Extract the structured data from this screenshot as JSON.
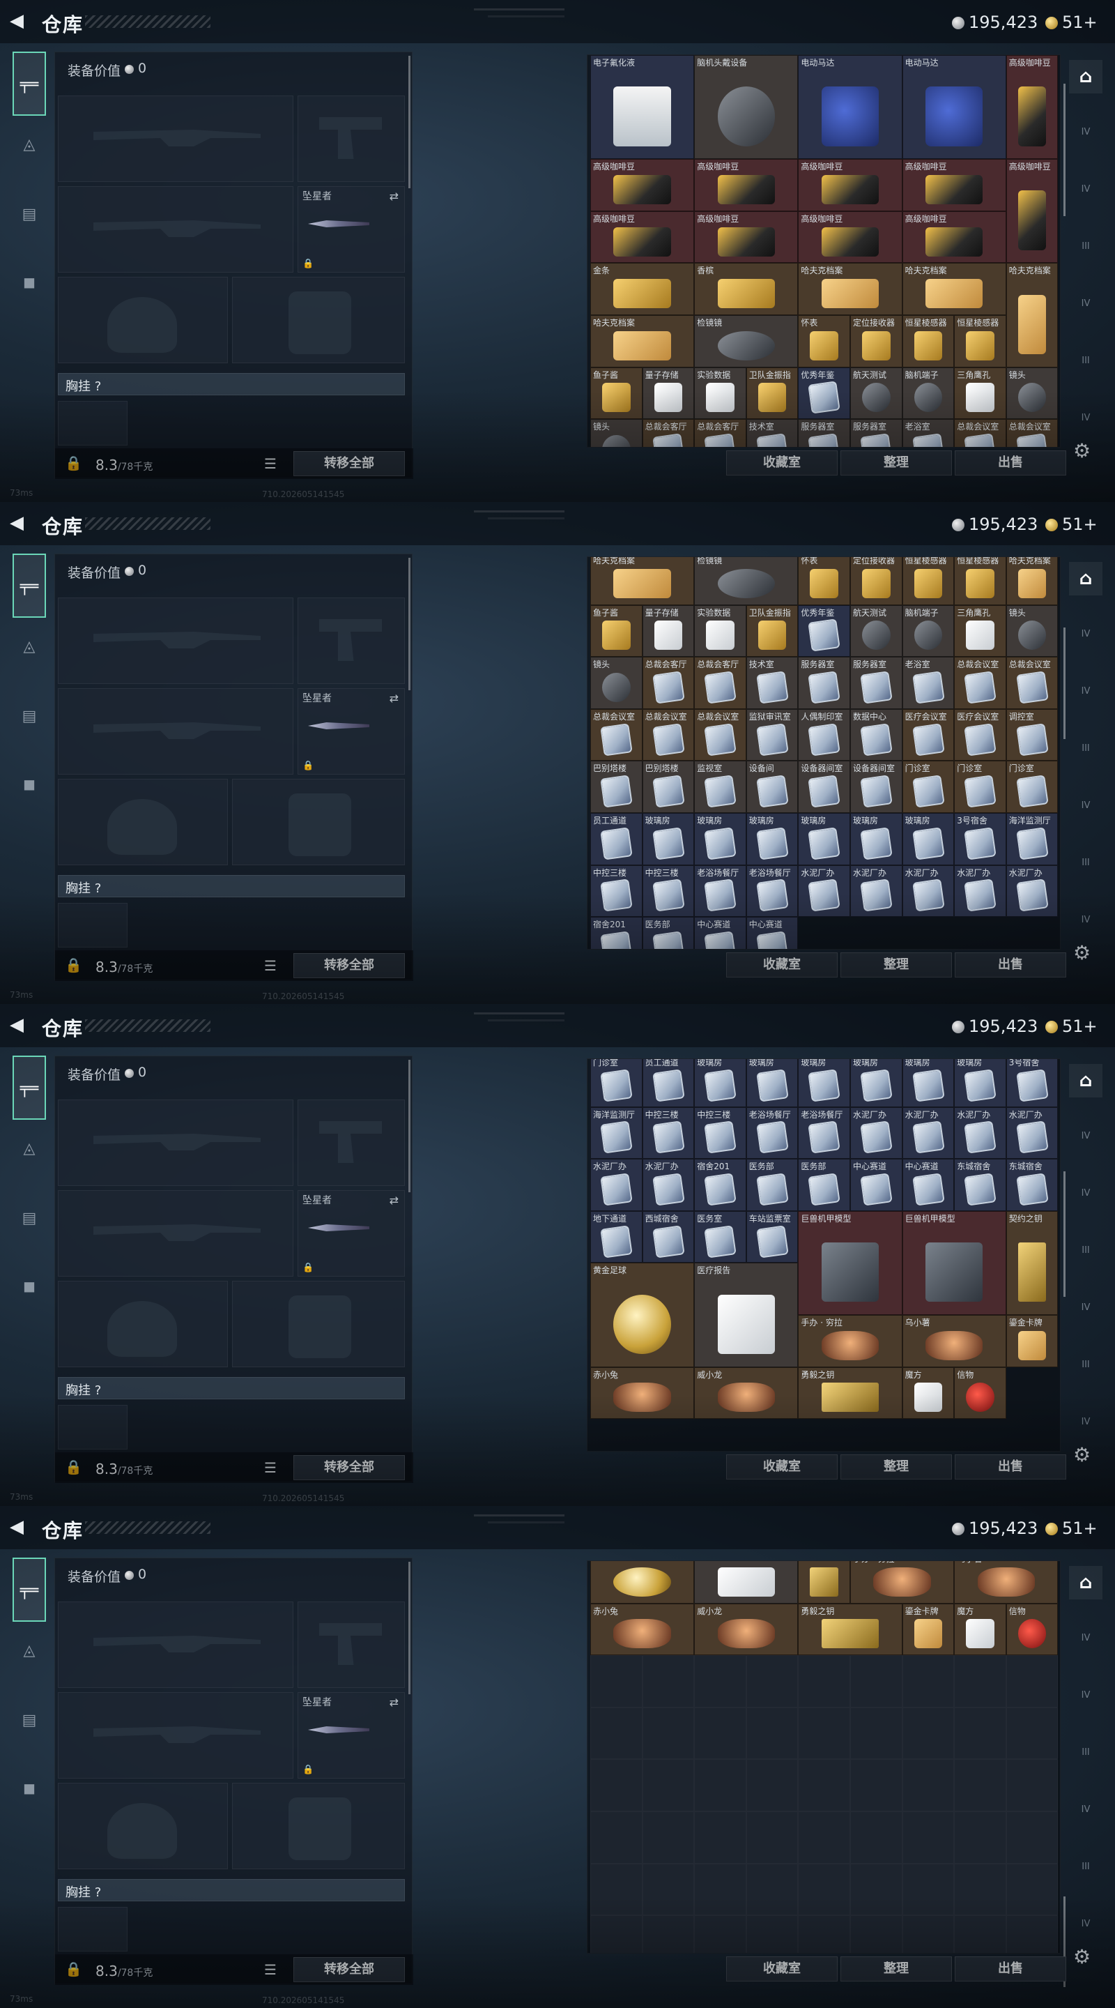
{
  "header": {
    "title": "仓库",
    "back": "◀",
    "silver": "195,423",
    "gold": "51+"
  },
  "loadout": {
    "value_label": "装备价值",
    "value": "0",
    "melee_label": "坠星者",
    "chest_label": "胸挂 ?",
    "weight": "8.3",
    "weight_unit": "/78千克",
    "transfer_label": "转移全部"
  },
  "actions": {
    "collection": "收藏室",
    "sort": "整理",
    "sell": "出售"
  },
  "footer": {
    "ping": "73ms",
    "build": "710.202605141545"
  },
  "left_nav": [
    "pistol-icon",
    "helmet-icon",
    "backpack-icon",
    "briefcase-icon"
  ],
  "right_nav": [
    "IV",
    "IV",
    "III",
    "IV",
    "III",
    "IV"
  ],
  "inventory": {
    "p1": [
      {
        "n": "电子氟化液",
        "c": "b",
        "i": "jug",
        "w": 2,
        "h": 2
      },
      {
        "n": "脑机头戴设备",
        "c": "g",
        "i": "dark",
        "w": 2,
        "h": 2
      },
      {
        "n": "电动马达",
        "c": "b",
        "i": "blue",
        "w": 2,
        "h": 2
      },
      {
        "n": "电动马达",
        "c": "b",
        "i": "blue",
        "w": 2,
        "h": 2
      },
      {
        "n": "高级咖啡豆",
        "c": "r",
        "i": "coffee",
        "w": 1,
        "h": 2
      },
      {
        "n": "高级咖啡豆",
        "c": "r",
        "i": "coffee",
        "w": 2,
        "h": 1
      },
      {
        "n": "高级咖啡豆",
        "c": "r",
        "i": "coffee",
        "w": 2,
        "h": 1
      },
      {
        "n": "高级咖啡豆",
        "c": "r",
        "i": "coffee",
        "w": 2,
        "h": 1
      },
      {
        "n": "高级咖啡豆",
        "c": "r",
        "i": "coffee",
        "w": 2,
        "h": 1
      },
      {
        "n": "高级咖啡豆",
        "c": "r",
        "i": "coffee",
        "w": 1,
        "h": 2
      },
      {
        "n": "高级咖啡豆",
        "c": "r",
        "i": "coffee",
        "w": 2,
        "h": 1
      },
      {
        "n": "高级咖啡豆",
        "c": "r",
        "i": "coffee",
        "w": 2,
        "h": 1
      },
      {
        "n": "高级咖啡豆",
        "c": "r",
        "i": "coffee",
        "w": 2,
        "h": 1
      },
      {
        "n": "高级咖啡豆",
        "c": "r",
        "i": "coffee",
        "w": 2,
        "h": 1
      },
      {
        "n": "金条",
        "c": "y",
        "i": "gold",
        "w": 2,
        "h": 1
      },
      {
        "n": "香槟",
        "c": "y",
        "i": "gold",
        "w": 2,
        "h": 1
      },
      {
        "n": "哈夫克档案",
        "c": "y",
        "i": "file",
        "w": 2,
        "h": 1
      },
      {
        "n": "哈夫克档案",
        "c": "y",
        "i": "file",
        "w": 2,
        "h": 1
      },
      {
        "n": "哈夫克档案",
        "c": "y",
        "i": "file",
        "w": 1,
        "h": 2
      },
      {
        "n": "哈夫克档案",
        "c": "y",
        "i": "file",
        "w": 2,
        "h": 1
      },
      {
        "n": "检镜镜",
        "c": "g",
        "i": "dark",
        "w": 2,
        "h": 1
      },
      {
        "n": "怀表",
        "c": "y",
        "i": "gold",
        "w": 1,
        "h": 1
      },
      {
        "n": "定位接收器",
        "c": "y",
        "i": "gold",
        "w": 1,
        "h": 1
      },
      {
        "n": "恒星棱感器",
        "c": "y",
        "i": "gold",
        "w": 1,
        "h": 1
      },
      {
        "n": "恒星棱感器",
        "c": "y",
        "i": "gold",
        "w": 1,
        "h": 1
      },
      {
        "n": "鱼子酱",
        "c": "y",
        "i": "gold",
        "w": 1,
        "h": 1
      },
      {
        "n": "量子存储",
        "c": "g",
        "i": "white",
        "w": 1,
        "h": 1
      },
      {
        "n": "实验数据",
        "c": "g",
        "i": "white",
        "w": 1,
        "h": 1
      },
      {
        "n": "卫队金振指",
        "c": "y",
        "i": "gold",
        "w": 1,
        "h": 1
      },
      {
        "n": "优秀年鉴",
        "c": "b",
        "i": "card",
        "w": 1,
        "h": 1
      },
      {
        "n": "航天测试",
        "c": "g",
        "i": "dark",
        "w": 1,
        "h": 1
      },
      {
        "n": "脑机端子",
        "c": "g",
        "i": "dark",
        "w": 1,
        "h": 1
      },
      {
        "n": "三角鹰孔",
        "c": "y",
        "i": "white",
        "w": 1,
        "h": 1
      },
      {
        "n": "镜头",
        "c": "g",
        "i": "dark",
        "w": 1,
        "h": 1
      },
      {
        "n": "镜头",
        "c": "g",
        "i": "dark",
        "w": 1,
        "h": 1
      },
      {
        "n": "总裁会客厅",
        "c": "y",
        "i": "card",
        "w": 1,
        "h": 1
      },
      {
        "n": "总裁会客厅",
        "c": "y",
        "i": "card",
        "w": 1,
        "h": 1
      },
      {
        "n": "技术室",
        "c": "g",
        "i": "card",
        "w": 1,
        "h": 1
      },
      {
        "n": "服务器室",
        "c": "g",
        "i": "card",
        "w": 1,
        "h": 1
      },
      {
        "n": "服务器室",
        "c": "g",
        "i": "card",
        "w": 1,
        "h": 1
      },
      {
        "n": "老浴室",
        "c": "g",
        "i": "card",
        "w": 1,
        "h": 1
      },
      {
        "n": "总裁会议室",
        "c": "y",
        "i": "card",
        "w": 1,
        "h": 1
      },
      {
        "n": "总裁会议室",
        "c": "y",
        "i": "card",
        "w": 1,
        "h": 1
      }
    ],
    "p2": [
      {
        "n": "哈夫克档案",
        "c": "y",
        "i": "file",
        "w": 2,
        "h": 1
      },
      {
        "n": "检镜镜",
        "c": "g",
        "i": "dark",
        "w": 2,
        "h": 1
      },
      {
        "n": "怀表",
        "c": "y",
        "i": "gold",
        "w": 1,
        "h": 1
      },
      {
        "n": "定位接收器",
        "c": "y",
        "i": "gold",
        "w": 1,
        "h": 1
      },
      {
        "n": "恒星棱感器",
        "c": "y",
        "i": "gold",
        "w": 1,
        "h": 1
      },
      {
        "n": "恒星棱感器",
        "c": "y",
        "i": "gold",
        "w": 1,
        "h": 1
      },
      {
        "n": "哈夫克档案",
        "c": "y",
        "i": "file",
        "w": 1,
        "h": 1
      },
      {
        "n": "鱼子酱",
        "c": "y",
        "i": "gold",
        "w": 1,
        "h": 1
      },
      {
        "n": "量子存储",
        "c": "g",
        "i": "white",
        "w": 1,
        "h": 1
      },
      {
        "n": "实验数据",
        "c": "g",
        "i": "white",
        "w": 1,
        "h": 1
      },
      {
        "n": "卫队金振指",
        "c": "y",
        "i": "gold",
        "w": 1,
        "h": 1
      },
      {
        "n": "优秀年鉴",
        "c": "b",
        "i": "card",
        "w": 1,
        "h": 1
      },
      {
        "n": "航天测试",
        "c": "g",
        "i": "dark",
        "w": 1,
        "h": 1
      },
      {
        "n": "脑机端子",
        "c": "g",
        "i": "dark",
        "w": 1,
        "h": 1
      },
      {
        "n": "三角鹰孔",
        "c": "y",
        "i": "white",
        "w": 1,
        "h": 1
      },
      {
        "n": "镜头",
        "c": "g",
        "i": "dark",
        "w": 1,
        "h": 1
      },
      {
        "n": "镜头",
        "c": "g",
        "i": "dark",
        "w": 1,
        "h": 1
      },
      {
        "n": "总裁会客厅",
        "c": "y",
        "i": "card",
        "w": 1,
        "h": 1
      },
      {
        "n": "总裁会客厅",
        "c": "y",
        "i": "card",
        "w": 1,
        "h": 1
      },
      {
        "n": "技术室",
        "c": "g",
        "i": "card",
        "w": 1,
        "h": 1
      },
      {
        "n": "服务器室",
        "c": "g",
        "i": "card",
        "w": 1,
        "h": 1
      },
      {
        "n": "服务器室",
        "c": "g",
        "i": "card",
        "w": 1,
        "h": 1
      },
      {
        "n": "老浴室",
        "c": "g",
        "i": "card",
        "w": 1,
        "h": 1
      },
      {
        "n": "总裁会议室",
        "c": "y",
        "i": "card",
        "w": 1,
        "h": 1
      },
      {
        "n": "总裁会议室",
        "c": "y",
        "i": "card",
        "w": 1,
        "h": 1
      },
      {
        "n": "总裁会议室",
        "c": "y",
        "i": "card",
        "w": 1,
        "h": 1
      },
      {
        "n": "总裁会议室",
        "c": "y",
        "i": "card",
        "w": 1,
        "h": 1
      },
      {
        "n": "总裁会议室",
        "c": "y",
        "i": "card",
        "w": 1,
        "h": 1
      },
      {
        "n": "监狱审讯室",
        "c": "g",
        "i": "card",
        "w": 1,
        "h": 1
      },
      {
        "n": "人偶制印室",
        "c": "g",
        "i": "card",
        "w": 1,
        "h": 1
      },
      {
        "n": "数据中心",
        "c": "g",
        "i": "card",
        "w": 1,
        "h": 1
      },
      {
        "n": "医疗会议室",
        "c": "y",
        "i": "card",
        "w": 1,
        "h": 1
      },
      {
        "n": "医疗会议室",
        "c": "y",
        "i": "card",
        "w": 1,
        "h": 1
      },
      {
        "n": "调控室",
        "c": "y",
        "i": "card",
        "w": 1,
        "h": 1
      },
      {
        "n": "巴别塔楼",
        "c": "g",
        "i": "card",
        "w": 1,
        "h": 1
      },
      {
        "n": "巴别塔楼",
        "c": "g",
        "i": "card",
        "w": 1,
        "h": 1
      },
      {
        "n": "监视室",
        "c": "g",
        "i": "card",
        "w": 1,
        "h": 1
      },
      {
        "n": "设备间",
        "c": "g",
        "i": "card",
        "w": 1,
        "h": 1
      },
      {
        "n": "设备器间室",
        "c": "g",
        "i": "card",
        "w": 1,
        "h": 1
      },
      {
        "n": "设备器间室",
        "c": "g",
        "i": "card",
        "w": 1,
        "h": 1
      },
      {
        "n": "门诊室",
        "c": "y",
        "i": "card",
        "w": 1,
        "h": 1
      },
      {
        "n": "门诊室",
        "c": "y",
        "i": "card",
        "w": 1,
        "h": 1
      },
      {
        "n": "门诊室",
        "c": "y",
        "i": "card",
        "w": 1,
        "h": 1
      },
      {
        "n": "员工通道",
        "c": "b",
        "i": "card",
        "w": 1,
        "h": 1
      },
      {
        "n": "玻璃房",
        "c": "b",
        "i": "card",
        "w": 1,
        "h": 1
      },
      {
        "n": "玻璃房",
        "c": "b",
        "i": "card",
        "w": 1,
        "h": 1
      },
      {
        "n": "玻璃房",
        "c": "b",
        "i": "card",
        "w": 1,
        "h": 1
      },
      {
        "n": "玻璃房",
        "c": "b",
        "i": "card",
        "w": 1,
        "h": 1
      },
      {
        "n": "玻璃房",
        "c": "b",
        "i": "card",
        "w": 1,
        "h": 1
      },
      {
        "n": "玻璃房",
        "c": "b",
        "i": "card",
        "w": 1,
        "h": 1
      },
      {
        "n": "3号宿舍",
        "c": "b",
        "i": "card",
        "w": 1,
        "h": 1
      },
      {
        "n": "海洋监测厅",
        "c": "b",
        "i": "card",
        "w": 1,
        "h": 1
      },
      {
        "n": "中控三楼",
        "c": "b",
        "i": "card",
        "w": 1,
        "h": 1
      },
      {
        "n": "中控三楼",
        "c": "b",
        "i": "card",
        "w": 1,
        "h": 1
      },
      {
        "n": "老浴场餐厅",
        "c": "b",
        "i": "card",
        "w": 1,
        "h": 1
      },
      {
        "n": "老浴场餐厅",
        "c": "b",
        "i": "card",
        "w": 1,
        "h": 1
      },
      {
        "n": "水泥厂办",
        "c": "b",
        "i": "card",
        "w": 1,
        "h": 1
      },
      {
        "n": "水泥厂办",
        "c": "b",
        "i": "card",
        "w": 1,
        "h": 1
      },
      {
        "n": "水泥厂办",
        "c": "b",
        "i": "card",
        "w": 1,
        "h": 1
      },
      {
        "n": "水泥厂办",
        "c": "b",
        "i": "card",
        "w": 1,
        "h": 1
      },
      {
        "n": "水泥厂办",
        "c": "b",
        "i": "card",
        "w": 1,
        "h": 1
      },
      {
        "n": "宿舍201",
        "c": "b",
        "i": "card",
        "w": 1,
        "h": 1
      },
      {
        "n": "医务部",
        "c": "b",
        "i": "card",
        "w": 1,
        "h": 1
      },
      {
        "n": "中心赛道",
        "c": "b",
        "i": "card",
        "w": 1,
        "h": 1
      },
      {
        "n": "中心赛道",
        "c": "b",
        "i": "card",
        "w": 1,
        "h": 1
      }
    ],
    "p3": [
      {
        "n": "门诊室",
        "c": "b",
        "i": "card",
        "w": 1,
        "h": 1
      },
      {
        "n": "员工通道",
        "c": "b",
        "i": "card",
        "w": 1,
        "h": 1
      },
      {
        "n": "玻璃房",
        "c": "b",
        "i": "card",
        "w": 1,
        "h": 1
      },
      {
        "n": "玻璃房",
        "c": "b",
        "i": "card",
        "w": 1,
        "h": 1
      },
      {
        "n": "玻璃房",
        "c": "b",
        "i": "card",
        "w": 1,
        "h": 1
      },
      {
        "n": "玻璃房",
        "c": "b",
        "i": "card",
        "w": 1,
        "h": 1
      },
      {
        "n": "玻璃房",
        "c": "b",
        "i": "card",
        "w": 1,
        "h": 1
      },
      {
        "n": "玻璃房",
        "c": "b",
        "i": "card",
        "w": 1,
        "h": 1
      },
      {
        "n": "3号宿舍",
        "c": "b",
        "i": "card",
        "w": 1,
        "h": 1
      },
      {
        "n": "海洋监测厅",
        "c": "b",
        "i": "card",
        "w": 1,
        "h": 1
      },
      {
        "n": "中控三楼",
        "c": "b",
        "i": "card",
        "w": 1,
        "h": 1
      },
      {
        "n": "中控三楼",
        "c": "b",
        "i": "card",
        "w": 1,
        "h": 1
      },
      {
        "n": "老浴场餐厅",
        "c": "b",
        "i": "card",
        "w": 1,
        "h": 1
      },
      {
        "n": "老浴场餐厅",
        "c": "b",
        "i": "card",
        "w": 1,
        "h": 1
      },
      {
        "n": "水泥厂办",
        "c": "b",
        "i": "card",
        "w": 1,
        "h": 1
      },
      {
        "n": "水泥厂办",
        "c": "b",
        "i": "card",
        "w": 1,
        "h": 1
      },
      {
        "n": "水泥厂办",
        "c": "b",
        "i": "card",
        "w": 1,
        "h": 1
      },
      {
        "n": "水泥厂办",
        "c": "b",
        "i": "card",
        "w": 1,
        "h": 1
      },
      {
        "n": "水泥厂办",
        "c": "b",
        "i": "card",
        "w": 1,
        "h": 1
      },
      {
        "n": "水泥厂办",
        "c": "b",
        "i": "card",
        "w": 1,
        "h": 1
      },
      {
        "n": "宿舍201",
        "c": "b",
        "i": "card",
        "w": 1,
        "h": 1
      },
      {
        "n": "医务部",
        "c": "b",
        "i": "card",
        "w": 1,
        "h": 1
      },
      {
        "n": "医务部",
        "c": "b",
        "i": "card",
        "w": 1,
        "h": 1
      },
      {
        "n": "中心赛道",
        "c": "b",
        "i": "card",
        "w": 1,
        "h": 1
      },
      {
        "n": "中心赛道",
        "c": "b",
        "i": "card",
        "w": 1,
        "h": 1
      },
      {
        "n": "东城宿舍",
        "c": "b",
        "i": "card",
        "w": 1,
        "h": 1
      },
      {
        "n": "东城宿舍",
        "c": "b",
        "i": "card",
        "w": 1,
        "h": 1
      },
      {
        "n": "地下通道",
        "c": "b",
        "i": "card",
        "w": 1,
        "h": 1
      },
      {
        "n": "西城宿舍",
        "c": "b",
        "i": "card",
        "w": 1,
        "h": 1
      },
      {
        "n": "医务室",
        "c": "b",
        "i": "card",
        "w": 1,
        "h": 1
      },
      {
        "n": "车站监票室",
        "c": "b",
        "i": "card",
        "w": 1,
        "h": 1
      },
      {
        "n": "巨兽机甲模型",
        "c": "r",
        "i": "mech",
        "w": 2,
        "h": 2
      },
      {
        "n": "巨兽机甲模型",
        "c": "r",
        "i": "mech",
        "w": 2,
        "h": 2
      },
      {
        "n": "黄金足球",
        "c": "y",
        "i": "ball",
        "w": 2,
        "h": 2
      },
      {
        "n": "医疗报告",
        "c": "g",
        "i": "white",
        "w": 2,
        "h": 2
      },
      {
        "n": "契约之钥",
        "c": "y",
        "i": "key",
        "w": 1,
        "h": 2
      },
      {
        "n": "手办 · 穷拉",
        "c": "y",
        "i": "doll",
        "w": 2,
        "h": 1
      },
      {
        "n": "乌小薯",
        "c": "y",
        "i": "doll",
        "w": 2,
        "h": 1
      },
      {
        "n": "赤小兔",
        "c": "y",
        "i": "doll",
        "w": 2,
        "h": 1
      },
      {
        "n": "威小龙",
        "c": "y",
        "i": "doll",
        "w": 2,
        "h": 1
      },
      {
        "n": "勇毅之钥",
        "c": "y",
        "i": "key",
        "w": 2,
        "h": 1
      },
      {
        "n": "鎏金卡牌",
        "c": "y",
        "i": "file",
        "w": 1,
        "h": 1
      },
      {
        "n": "魔方",
        "c": "y",
        "i": "white",
        "w": 1,
        "h": 1
      },
      {
        "n": "信物",
        "c": "y",
        "i": "red",
        "w": 1,
        "h": 1
      }
    ],
    "p4": [
      {
        "n": "",
        "c": "y",
        "i": "ball",
        "w": 2,
        "h": 1
      },
      {
        "n": "",
        "c": "g",
        "i": "white",
        "w": 2,
        "h": 1
      },
      {
        "n": "",
        "c": "y",
        "i": "key",
        "w": 1,
        "h": 1
      },
      {
        "n": "手办 · 穷拉",
        "c": "y",
        "i": "doll",
        "w": 2,
        "h": 1
      },
      {
        "n": "乌小薯",
        "c": "y",
        "i": "doll",
        "w": 2,
        "h": 1
      },
      {
        "n": "赤小兔",
        "c": "y",
        "i": "doll",
        "w": 2,
        "h": 1
      },
      {
        "n": "威小龙",
        "c": "y",
        "i": "doll",
        "w": 2,
        "h": 1
      },
      {
        "n": "勇毅之钥",
        "c": "y",
        "i": "key",
        "w": 2,
        "h": 1
      },
      {
        "n": "鎏金卡牌",
        "c": "y",
        "i": "file",
        "w": 1,
        "h": 1
      },
      {
        "n": "魔方",
        "c": "y",
        "i": "white",
        "w": 1,
        "h": 1
      },
      {
        "n": "信物",
        "c": "y",
        "i": "red",
        "w": 1,
        "h": 1
      }
    ]
  },
  "colors": {
    "accent": "#6bd7b8",
    "rare_red": "#4a2a2e",
    "rare_blue": "#2a3148",
    "rare_gold": "#4a3b2b",
    "rare_grey": "#3f3a38"
  }
}
